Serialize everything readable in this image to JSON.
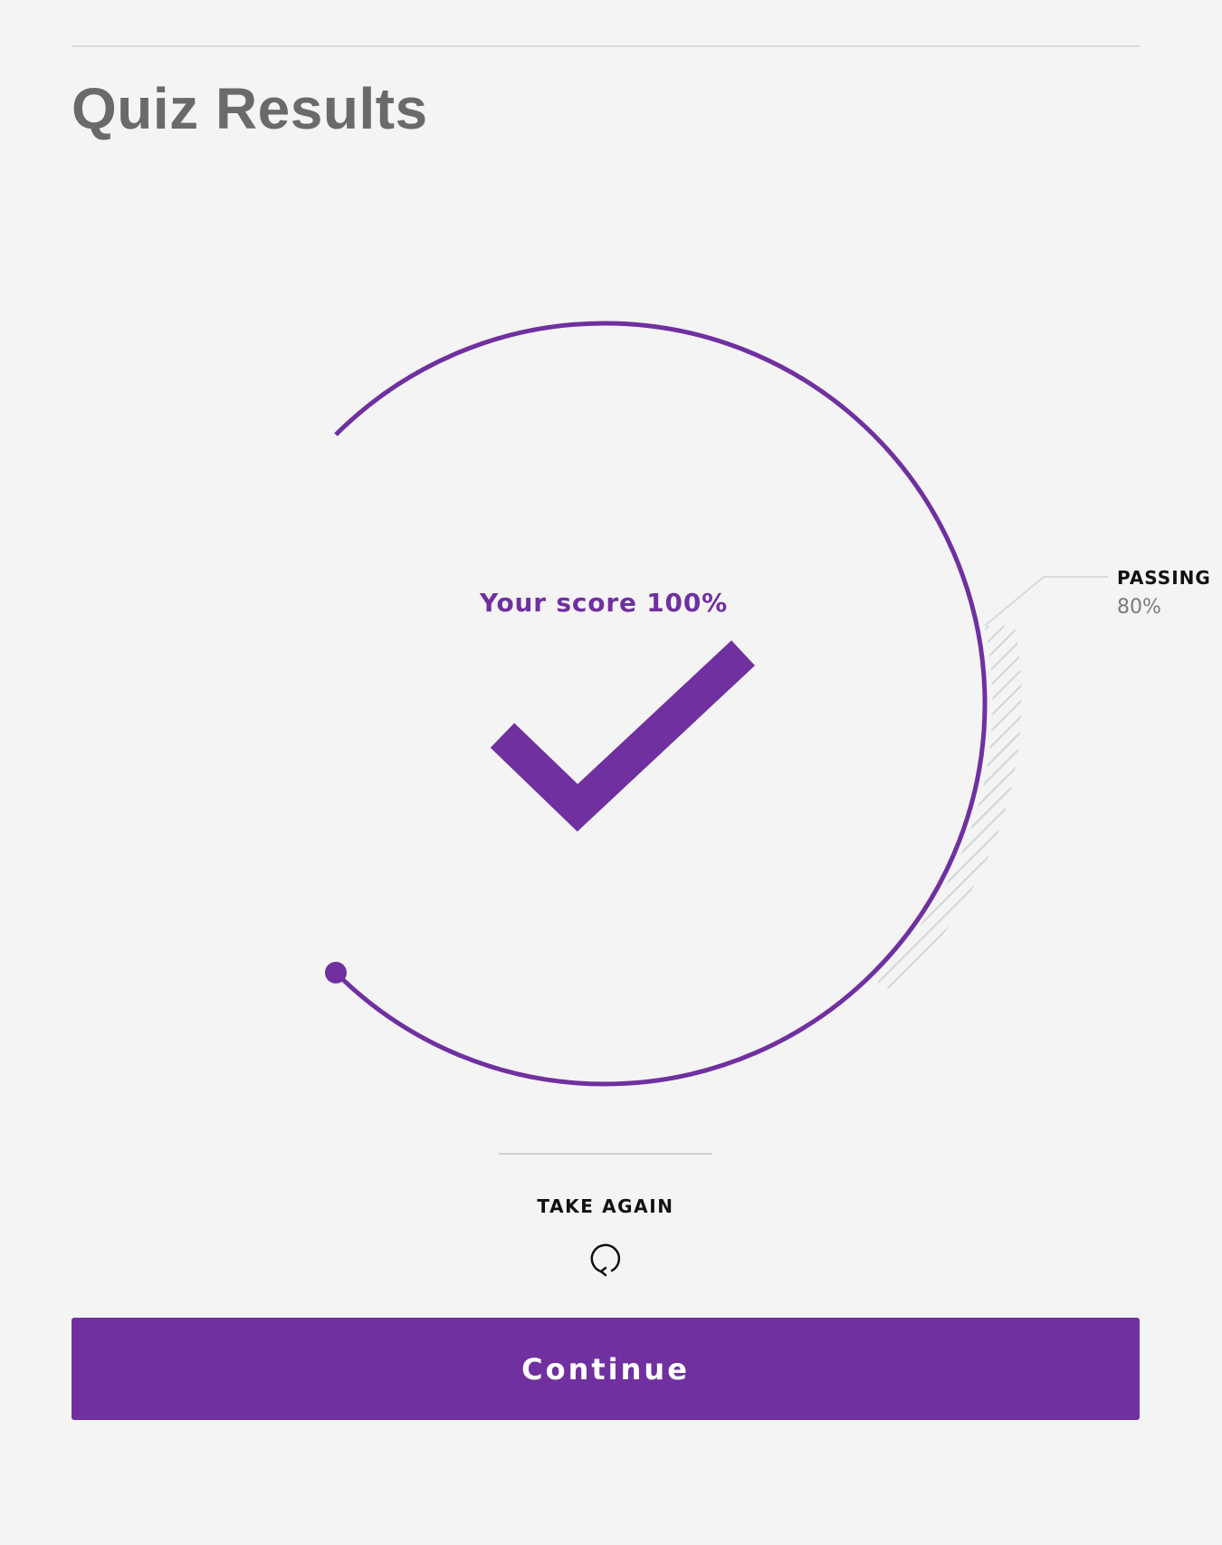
{
  "header": {
    "title": "Quiz Results"
  },
  "result": {
    "score_text": "Your score 100%",
    "score_percent": 100,
    "passing_label": "PASSING",
    "passing_value": "80%",
    "passing_percent": 80,
    "status_icon": "checkmark-icon"
  },
  "actions": {
    "take_again_label": "TAKE AGAIN",
    "take_again_icon": "refresh-icon",
    "continue_label": "Continue"
  },
  "colors": {
    "accent": "#7030a0",
    "background": "#f4f4f4",
    "title": "#6a6a6a",
    "hatch": "#d4d4d4"
  }
}
